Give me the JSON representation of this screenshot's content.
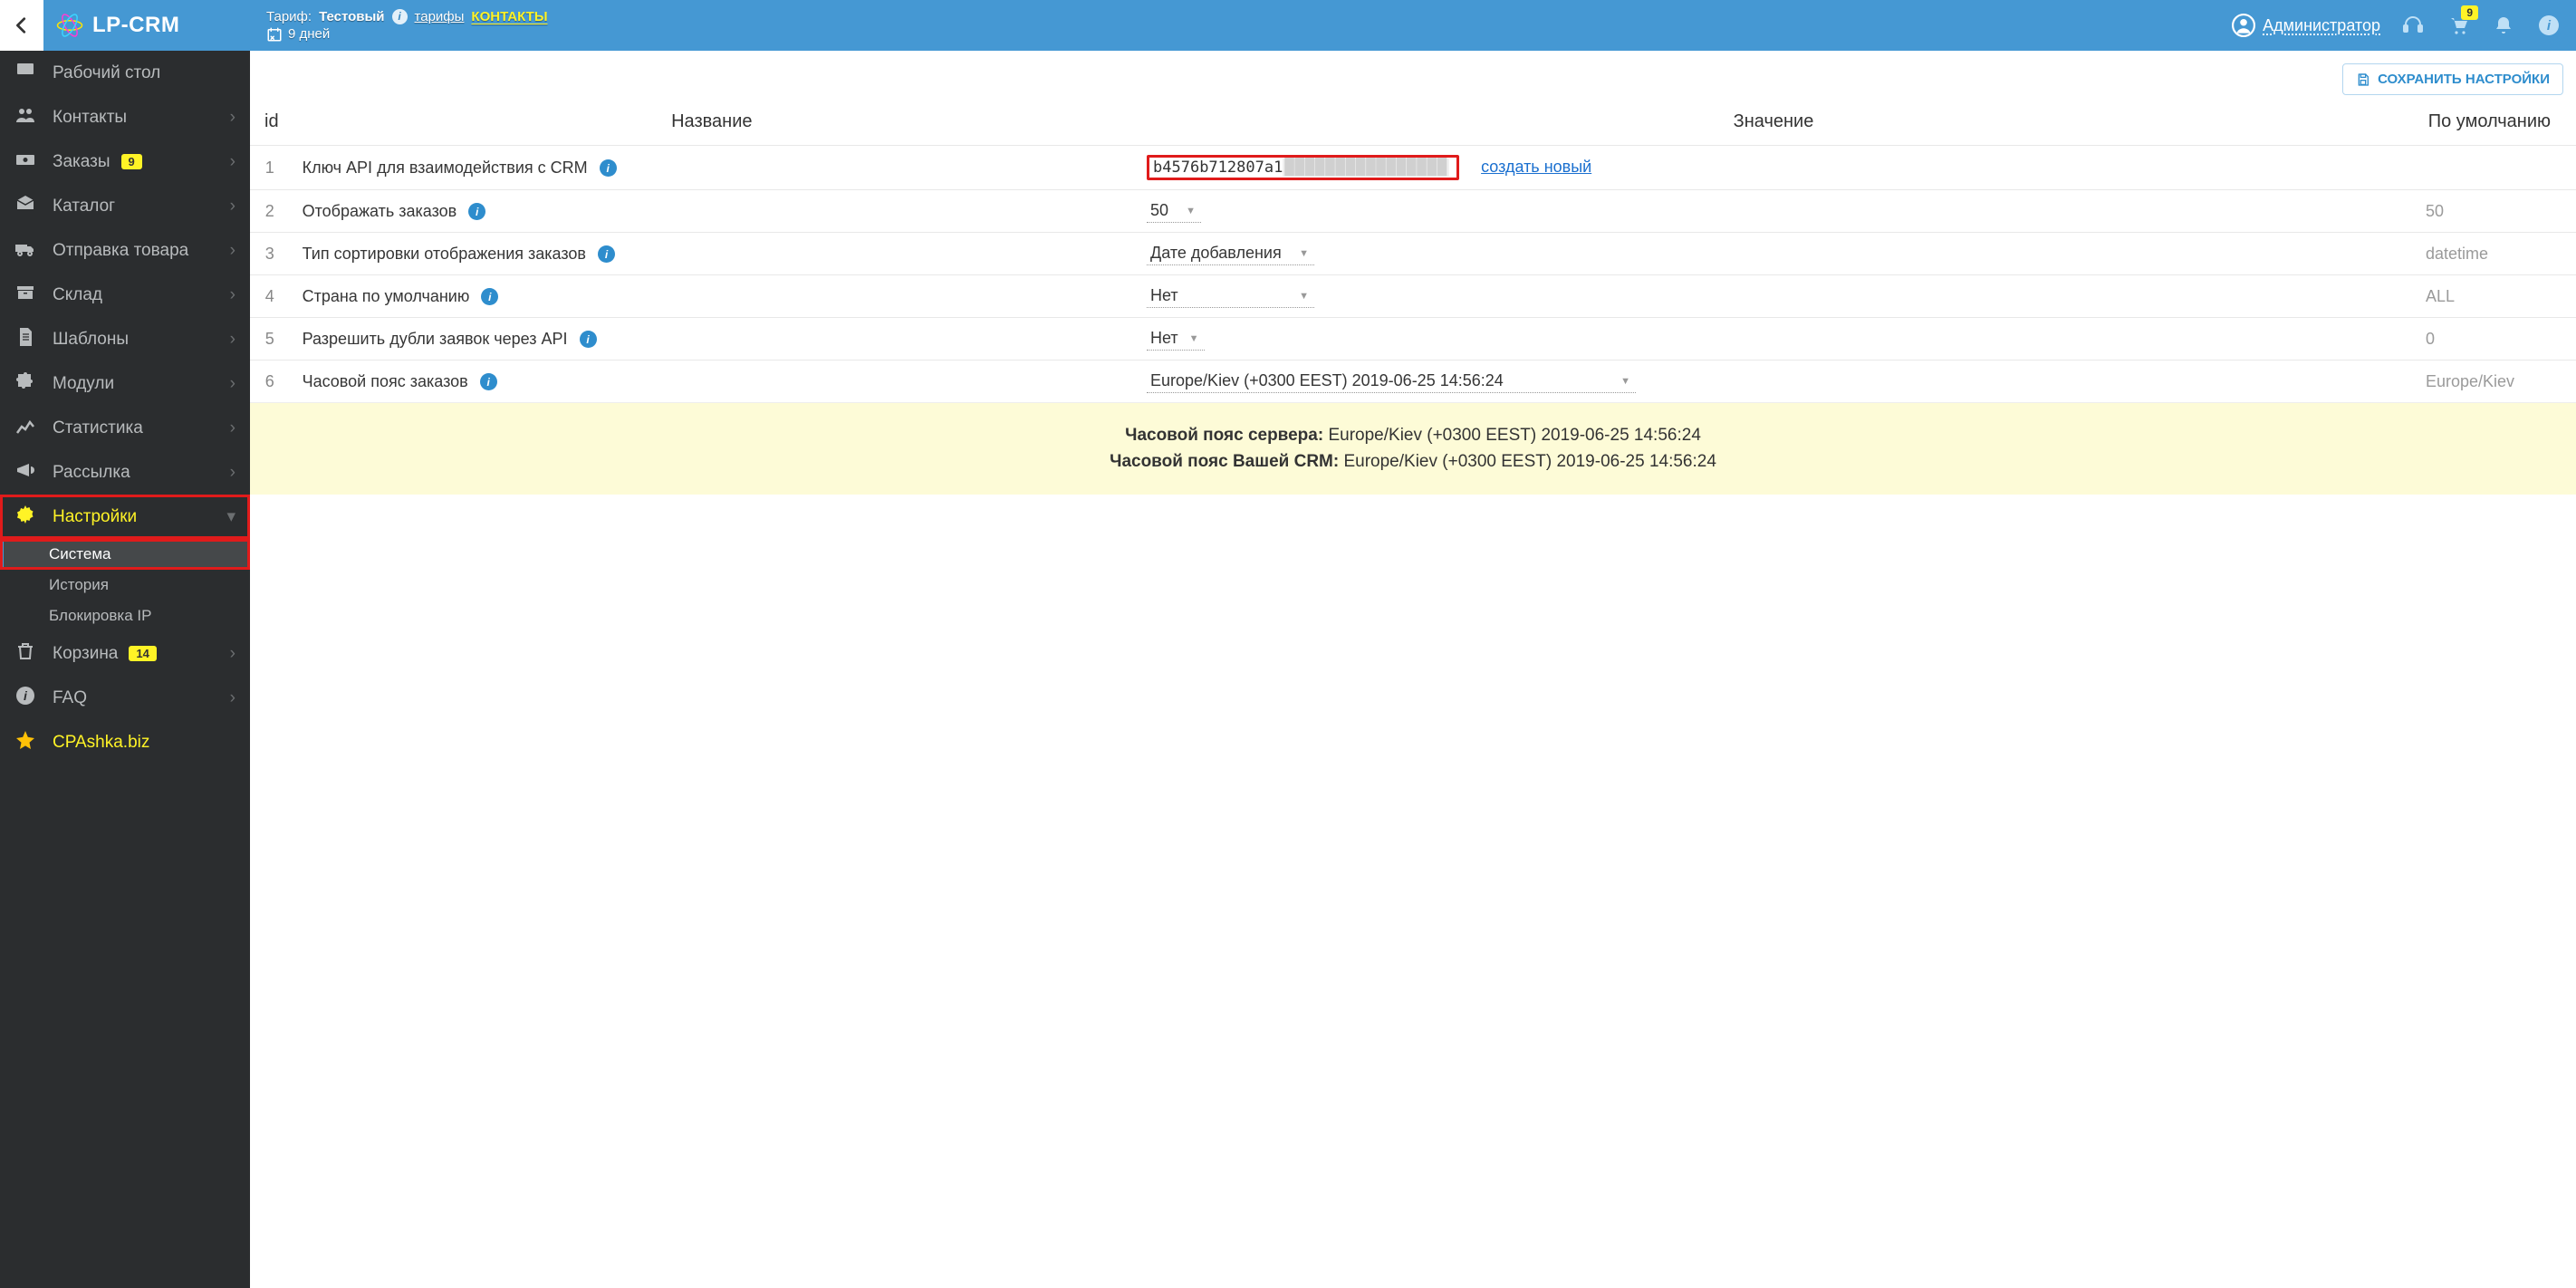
{
  "brand": "LP-CRM",
  "top": {
    "tariff_label": "Тариф:",
    "tariff_name": "Тестовый",
    "tariffs_link": "тарифы",
    "contacts": "КОНТАКТЫ",
    "days": "9 дней",
    "user": "Администратор",
    "cart_badge": "9"
  },
  "sidebar": {
    "items": [
      {
        "label": "Рабочий стол",
        "icon": "desktop"
      },
      {
        "label": "Контакты",
        "icon": "users",
        "chev": true
      },
      {
        "label": "Заказы",
        "icon": "cash",
        "chev": true,
        "badge": "9"
      },
      {
        "label": "Каталог",
        "icon": "inbox",
        "chev": true
      },
      {
        "label": "Отправка товара",
        "icon": "truck",
        "chev": true
      },
      {
        "label": "Склад",
        "icon": "archive",
        "chev": true
      },
      {
        "label": "Шаблоны",
        "icon": "doc",
        "chev": true
      },
      {
        "label": "Модули",
        "icon": "puzzle",
        "chev": true
      },
      {
        "label": "Статистика",
        "icon": "chart",
        "chev": true
      },
      {
        "label": "Рассылка",
        "icon": "bullhorn",
        "chev": true
      },
      {
        "label": "Настройки",
        "icon": "gear",
        "chev": "down",
        "active": true,
        "hl": true
      }
    ],
    "sub": [
      {
        "label": "Система",
        "sel": true,
        "hl": true
      },
      {
        "label": "История"
      },
      {
        "label": "Блокировка IP"
      }
    ],
    "trash": {
      "label": "Корзина",
      "badge": "14"
    },
    "faq": {
      "label": "FAQ"
    },
    "cpa": {
      "label": "CPAshka.biz"
    }
  },
  "actions": {
    "save": "СОХРАНИТЬ НАСТРОЙКИ"
  },
  "table": {
    "head": {
      "id": "id",
      "name": "Название",
      "value": "Значение",
      "def": "По умолчанию"
    },
    "rows": [
      {
        "id": "1",
        "name": "Ключ API для взаимодействия с CRM",
        "value": "b4576b712807a1",
        "masked": "████████████████",
        "link": "создать новый",
        "def": ""
      },
      {
        "id": "2",
        "name": "Отображать заказов",
        "value": "50",
        "def": "50"
      },
      {
        "id": "3",
        "name": "Тип сортировки отображения заказов",
        "value": "Дате добавления",
        "def": "datetime"
      },
      {
        "id": "4",
        "name": "Страна по умолчанию",
        "value": "Нет",
        "def": "ALL"
      },
      {
        "id": "5",
        "name": "Разрешить дубли заявок через API",
        "value": "Нет",
        "def": "0"
      },
      {
        "id": "6",
        "name": "Часовой пояс заказов",
        "value": "Europe/Kiev (+0300 EEST) 2019-06-25 14:56:24",
        "def": "Europe/Kiev"
      }
    ]
  },
  "tz": {
    "server_l": "Часовой пояс сервера:",
    "server_v": "Europe/Kiev (+0300 EEST) 2019-06-25 14:56:24",
    "crm_l": "Часовой пояс Вашей CRM:",
    "crm_v": "Europe/Kiev (+0300 EEST) 2019-06-25 14:56:24"
  }
}
